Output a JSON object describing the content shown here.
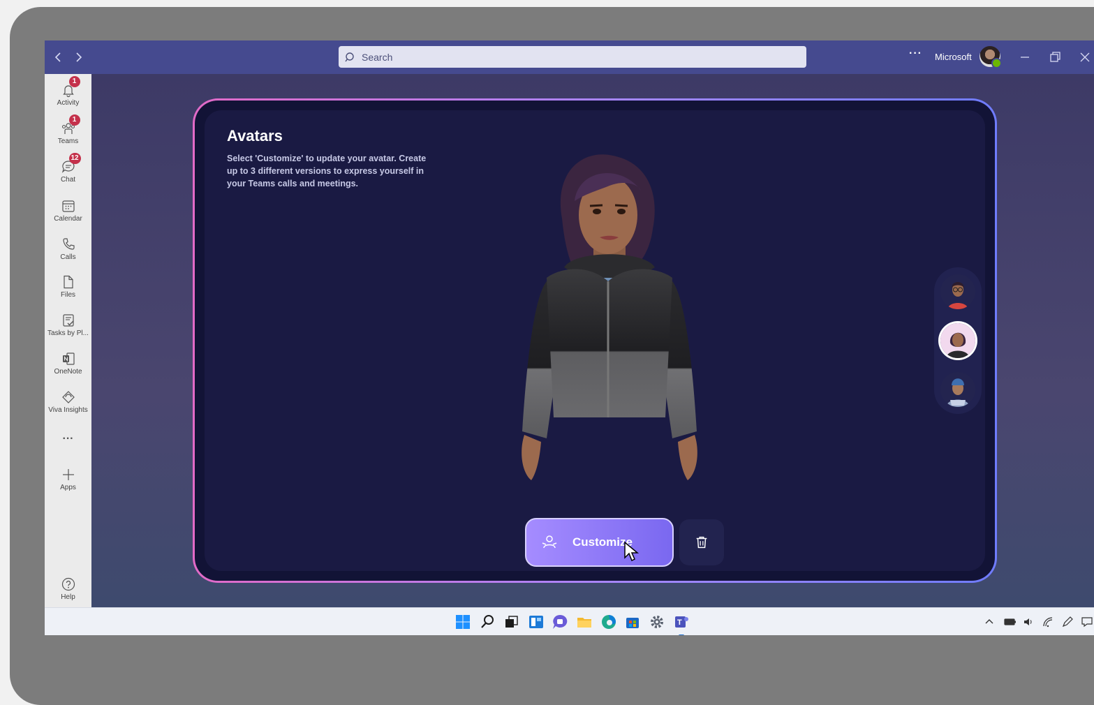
{
  "titlebar": {
    "search_placeholder": "Search",
    "more_label": "···",
    "org_name": "Microsoft"
  },
  "rail": {
    "items": [
      {
        "label": "Activity",
        "icon": "bell-icon",
        "badge": "1"
      },
      {
        "label": "Teams",
        "icon": "teams-icon",
        "badge": "1"
      },
      {
        "label": "Chat",
        "icon": "chat-icon",
        "badge": "12"
      },
      {
        "label": "Calendar",
        "icon": "calendar-icon",
        "badge": ""
      },
      {
        "label": "Calls",
        "icon": "phone-icon",
        "badge": ""
      },
      {
        "label": "Files",
        "icon": "file-icon",
        "badge": ""
      },
      {
        "label": "Tasks by Pl...",
        "icon": "tasks-icon",
        "badge": ""
      },
      {
        "label": "OneNote",
        "icon": "onenote-icon",
        "badge": ""
      },
      {
        "label": "Viva Insights",
        "icon": "viva-insights-icon",
        "badge": ""
      }
    ],
    "more_label": "···",
    "apps_label": "Apps",
    "help_label": "Help"
  },
  "avatars": {
    "title": "Avatars",
    "description": "Select 'Customize' to update your avatar. Create up to 3 different versions to express yourself in your Teams calls and meetings.",
    "customize_label": "Customize",
    "selected_index": 1
  },
  "colors": {
    "titlebar": "#454a8f",
    "accent_gradient_start": "#a58cff",
    "accent_gradient_end": "#7a68f0",
    "badge": "#c4314b",
    "presence": "#6bb700"
  }
}
